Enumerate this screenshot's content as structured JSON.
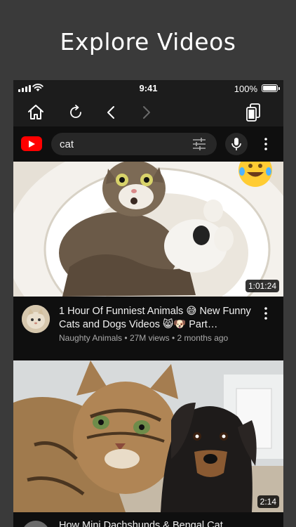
{
  "headline": "Explore Videos",
  "status_bar": {
    "time": "9:41",
    "battery_percent": "100%",
    "battery_level": 1.0
  },
  "browser_toolbar": {
    "buttons": [
      {
        "name": "home",
        "icon": "home-icon"
      },
      {
        "name": "reload",
        "icon": "reload-icon"
      },
      {
        "name": "back",
        "icon": "chevron-left-icon"
      },
      {
        "name": "forward",
        "icon": "chevron-right-icon"
      },
      {
        "name": "tabs",
        "icon": "tabs-icon"
      }
    ]
  },
  "youtube": {
    "search_query": "cat",
    "icons": [
      "youtube-logo-icon",
      "filter-icon",
      "mic-icon",
      "more-vertical-icon"
    ]
  },
  "videos": [
    {
      "title": "1 Hour Of Funniest Animals 😅 New Funny Cats and Dogs Videos 😸🐶 Part…",
      "channel": "Naughty Animals",
      "views": "27M views",
      "age": "2 months ago",
      "separator": "•",
      "duration": "1:01:24",
      "badge_emoji": "😂"
    },
    {
      "title": "How Mini Dachshunds & Bengal Cat",
      "duration": "2:14"
    }
  ],
  "colors": {
    "background": "#3a3a3a",
    "app_background": "#0f0f0f",
    "toolbar": "#1c1c1c",
    "search_box": "#272727",
    "youtube_red": "#ff0000",
    "secondary_text": "#aaaaaa"
  }
}
